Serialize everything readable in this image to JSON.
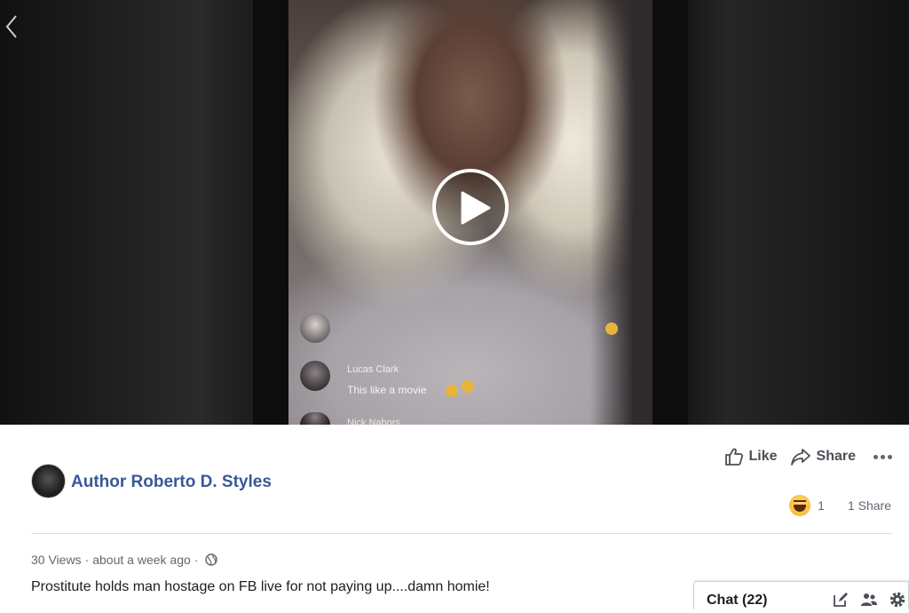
{
  "video": {
    "live_comments": [
      {
        "name": "",
        "text": ""
      },
      {
        "name": "Lucas Clark",
        "text": "This like a movie"
      },
      {
        "name": "Nick Nabors",
        "text": ""
      }
    ]
  },
  "post": {
    "author": "Author Roberto D. Styles",
    "actions": {
      "like_label": "Like",
      "share_label": "Share"
    },
    "reactions": {
      "count": "1",
      "shares": "1 Share"
    },
    "meta": {
      "views": "30 Views",
      "time": "about a week ago"
    },
    "caption": "Prostitute holds man hostage on FB live for not paying up....damn homie!"
  },
  "chat": {
    "label": "Chat (22)"
  },
  "icons": {
    "back": "chevron-left-icon",
    "play": "play-icon",
    "like": "thumbs-up-icon",
    "share": "share-arrow-icon",
    "more": "ellipsis-icon",
    "haha": "haha-reaction-icon",
    "privacy": "globe-icon",
    "compose": "compose-icon",
    "people": "people-icon",
    "settings": "gear-icon"
  },
  "colors": {
    "link": "#385898",
    "text": "#1c1e21",
    "muted": "#606770"
  }
}
